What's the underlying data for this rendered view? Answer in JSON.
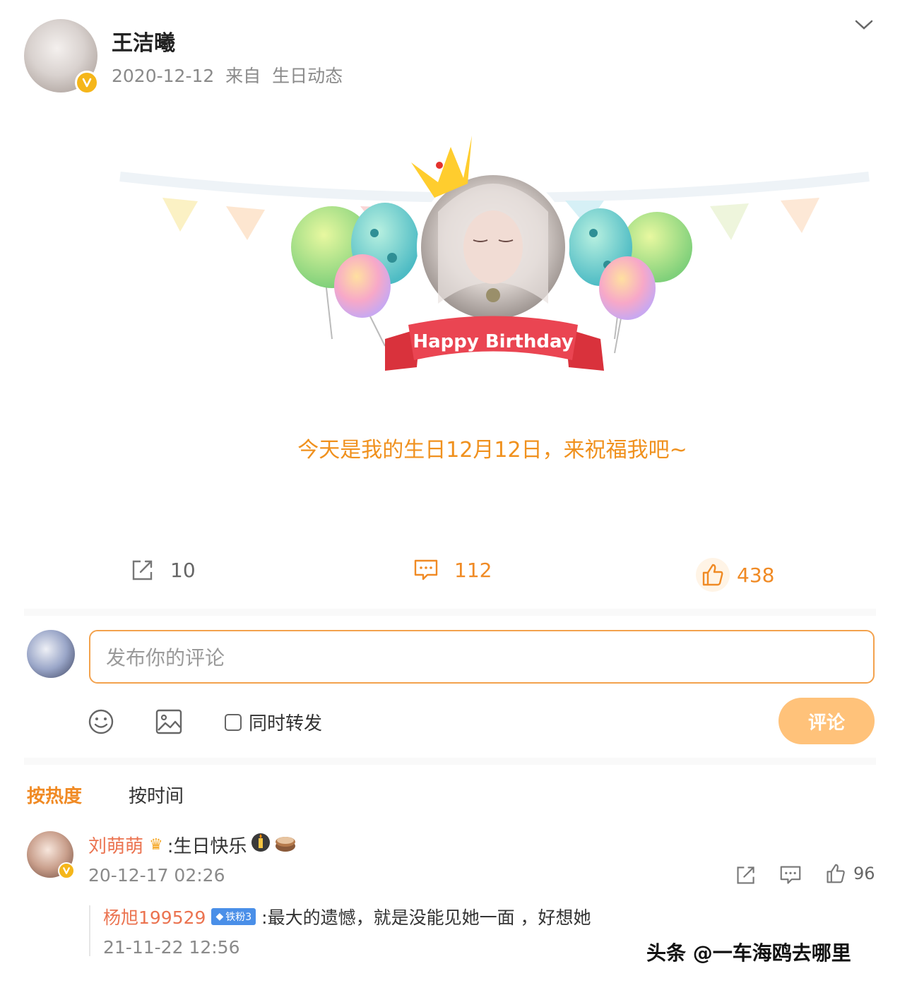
{
  "post": {
    "author": "王洁曦",
    "meta": "2020-12-12  来自  生日动态",
    "banner_text": "Happy Birthday",
    "body_text": "今天是我的生日12月12日，来祝福我吧~",
    "actions": {
      "reposts": "10",
      "comments": "112",
      "likes": "438"
    }
  },
  "composer": {
    "placeholder": "发布你的评论",
    "also_repost_label": "同时转发",
    "submit_label": "评论"
  },
  "sort_tabs": {
    "hot": "按热度",
    "time": "按时间"
  },
  "comments": [
    {
      "user": "刘萌萌",
      "text": ":生日快乐",
      "time": "20-12-17 02:26",
      "likes": "96",
      "reply": {
        "user": "杨旭199529",
        "badge": "铁粉3",
        "text": ":最大的遗憾，就是没能见她一面 ，好想她",
        "time": "21-11-22 12:56"
      }
    }
  ],
  "watermark": "头条 @一车海鸥去哪里",
  "colors": {
    "accent": "#ff8200",
    "verified": "#f5b61a",
    "button": "#ffc27a"
  }
}
